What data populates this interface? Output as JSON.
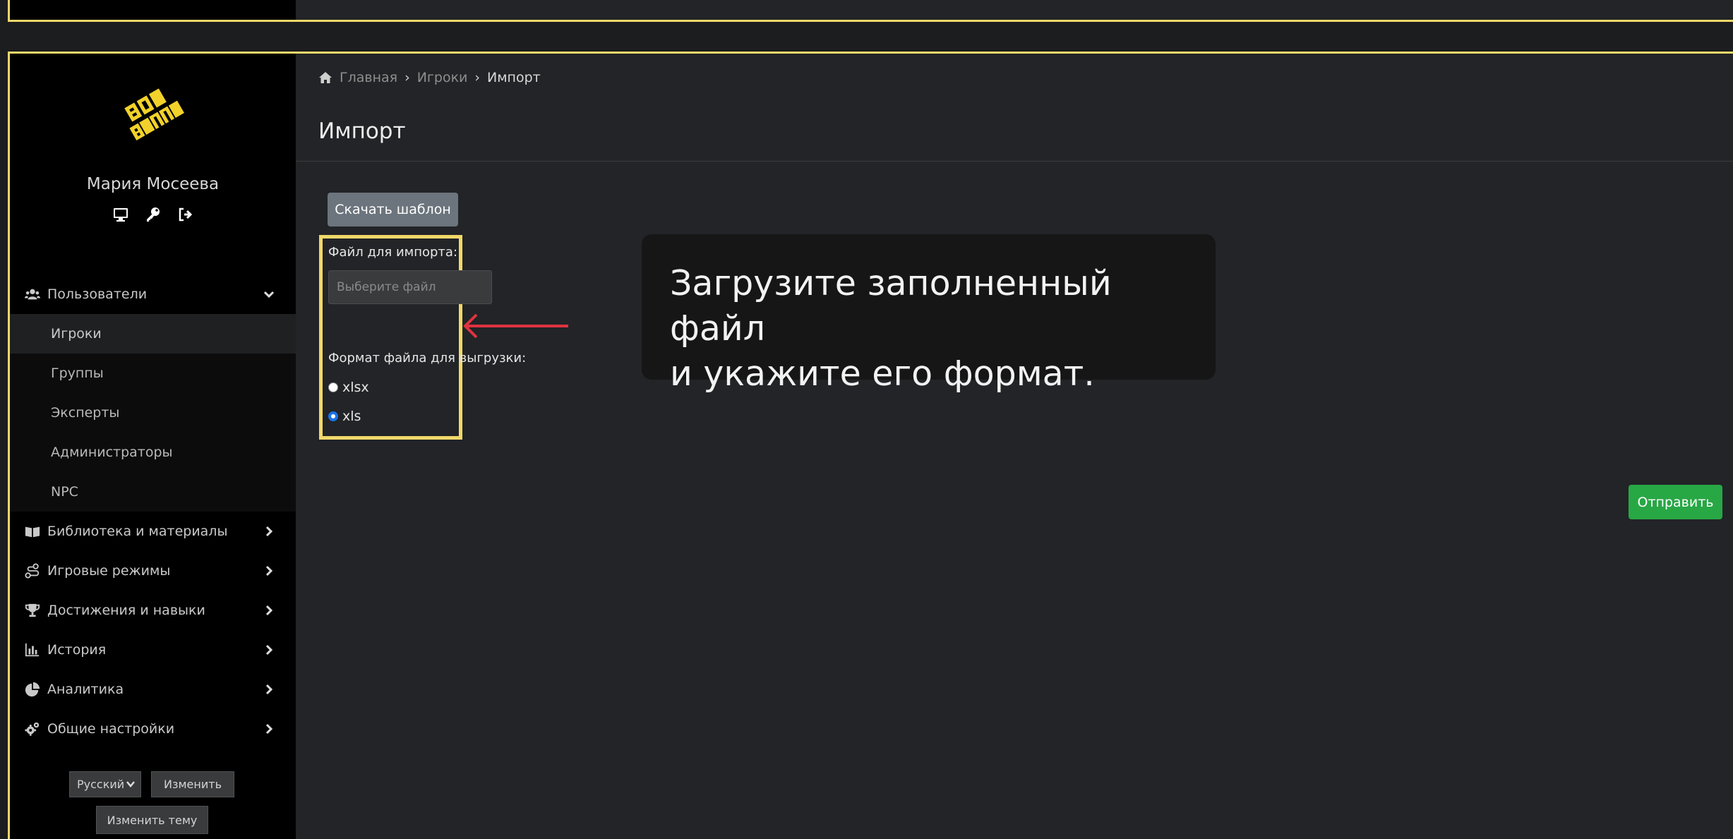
{
  "user": {
    "name": "Мария Мосеева"
  },
  "icons": {
    "monitor": "monitor-icon",
    "key": "key-icon",
    "logout": "sign-out-icon"
  },
  "sidebar": {
    "sections": [
      {
        "label": "Пользователи",
        "icon": "users-icon",
        "expanded": true,
        "items": [
          {
            "label": "Игроки",
            "active": true
          },
          {
            "label": "Группы"
          },
          {
            "label": "Эксперты"
          },
          {
            "label": "Администраторы"
          },
          {
            "label": "NPC"
          }
        ]
      },
      {
        "label": "Библиотека и материалы",
        "icon": "book-icon"
      },
      {
        "label": "Игровые режимы",
        "icon": "route-icon"
      },
      {
        "label": "Достижения и навыки",
        "icon": "trophy-icon"
      },
      {
        "label": "История",
        "icon": "chart-icon"
      },
      {
        "label": "Аналитика",
        "icon": "pie-icon"
      },
      {
        "label": "Общие настройки",
        "icon": "gears-icon"
      }
    ],
    "language": {
      "value": "Русский"
    },
    "change_label": "Изменить",
    "change_theme_label": "Изменить тему"
  },
  "breadcrumb": {
    "home": "Главная",
    "players": "Игроки",
    "current": "Импорт",
    "separator": "›"
  },
  "page": {
    "title": "Импорт",
    "download_template": "Скачать шаблон",
    "file_label": "Файл для импорта:",
    "file_placeholder": "Выберите файл",
    "format_label": "Формат файла для выгрузки:",
    "formats": [
      {
        "label": "xlsx",
        "checked": false
      },
      {
        "label": "xls",
        "checked": true
      }
    ],
    "submit": "Отправить"
  },
  "callout": {
    "line1": "Загрузите заполненный файл",
    "line2": "и укажите его формат."
  },
  "colors": {
    "highlight": "#f2d86a",
    "arrow": "#e0323f",
    "submit": "#28a745",
    "secondary": "#6c757d"
  }
}
